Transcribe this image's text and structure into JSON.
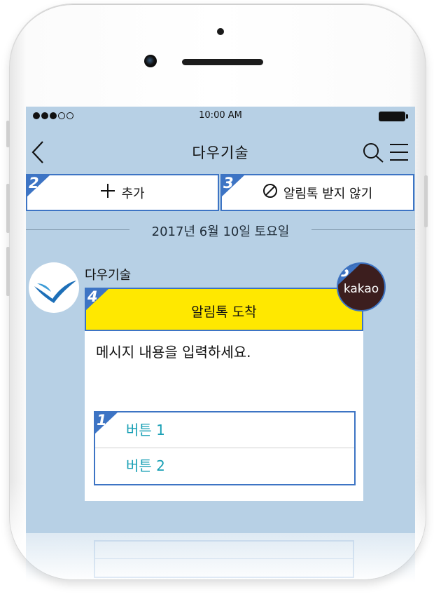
{
  "status_bar": {
    "time": "10:00 AM",
    "signal_icon": "signal-dots-icon",
    "battery_icon": "battery-icon"
  },
  "navbar": {
    "title": "다우기술",
    "back_icon": "chevron-left-icon",
    "search_icon": "search-icon",
    "menu_icon": "hamburger-menu-icon"
  },
  "actions": {
    "add": {
      "badge": "2",
      "label": "추가",
      "icon": "plus-icon"
    },
    "block": {
      "badge": "3",
      "label": "알림톡 받지 않기",
      "icon": "block-icon"
    }
  },
  "chat": {
    "date": "2017년 6월 10일 토요일",
    "sender": "다우기술",
    "card": {
      "badge": "4",
      "title": "알림톡 도착",
      "message": "메시지 내용을 입력하세요.",
      "buttons_badge": "1",
      "buttons": [
        "버튼 1",
        "버튼 2"
      ]
    },
    "kakao": {
      "badge": "5",
      "label": "kakao"
    }
  },
  "colors": {
    "screen_bg": "#b7d0e5",
    "accent_border": "#3d74c4",
    "card_header": "#ffe800",
    "button_text": "#1aa0b5",
    "kakao_bg": "#3c1e1e"
  }
}
